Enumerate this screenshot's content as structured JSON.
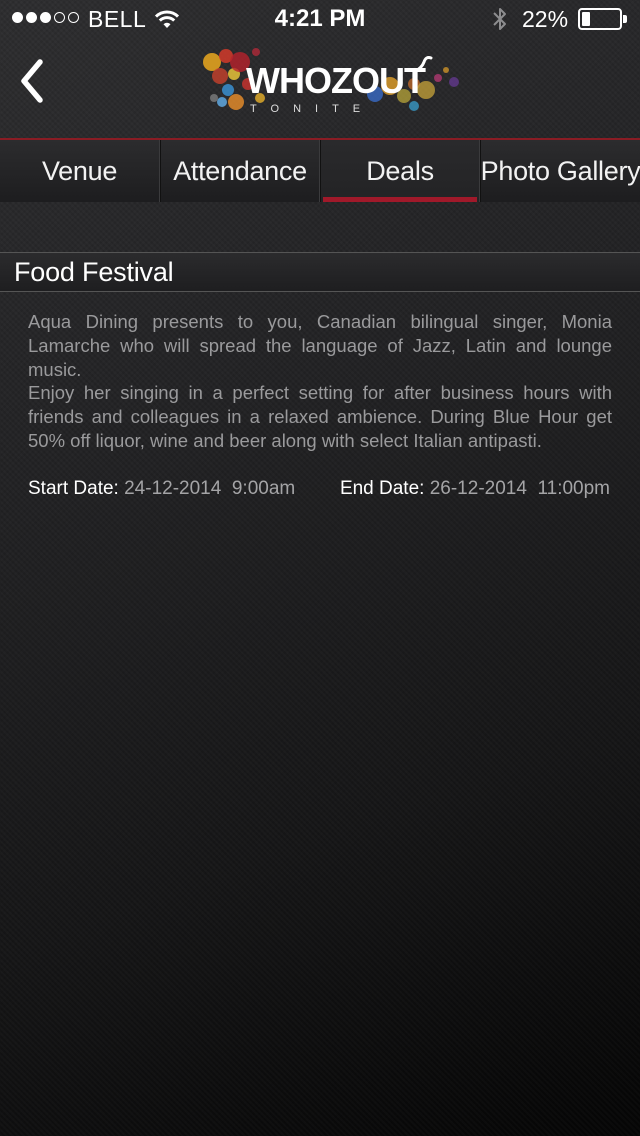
{
  "status_bar": {
    "carrier": "BELL",
    "time": "4:21 PM",
    "battery_percent": "22%",
    "battery_level": 0.22,
    "signal_bars_total": 5,
    "signal_bars_filled": 3,
    "icons": [
      "wifi-icon",
      "bluetooth-icon",
      "battery-icon"
    ]
  },
  "nav": {
    "back_icon": "chevron-left-icon",
    "logo_text": "WHOZOUT",
    "logo_subtext": "TONITE"
  },
  "tabs": [
    {
      "label": "Venue",
      "active": false
    },
    {
      "label": "Attendance",
      "active": false
    },
    {
      "label": "Deals",
      "active": true
    },
    {
      "label": "Photo Gallery",
      "active": false
    }
  ],
  "deal": {
    "title": "Food Festival",
    "description_1": "Aqua Dining presents to you, Canadian bilingual singer, Monia Lamarche who will spread the language of Jazz, Latin and lounge music.",
    "description_2": "Enjoy her singing in a perfect setting for after business hours with friends and colleagues in a relaxed ambience. During Blue Hour get 50% off liquor, wine and beer along with select Italian antipasti.",
    "start_label": "Start Date:",
    "start_value": "24-12-2014  9:00am",
    "end_label": "End Date:",
    "end_value": "26-12-2014  11:00pm"
  },
  "colors": {
    "accent": "#a0192a",
    "background": "#232325",
    "text_muted": "#9a9a9c"
  }
}
